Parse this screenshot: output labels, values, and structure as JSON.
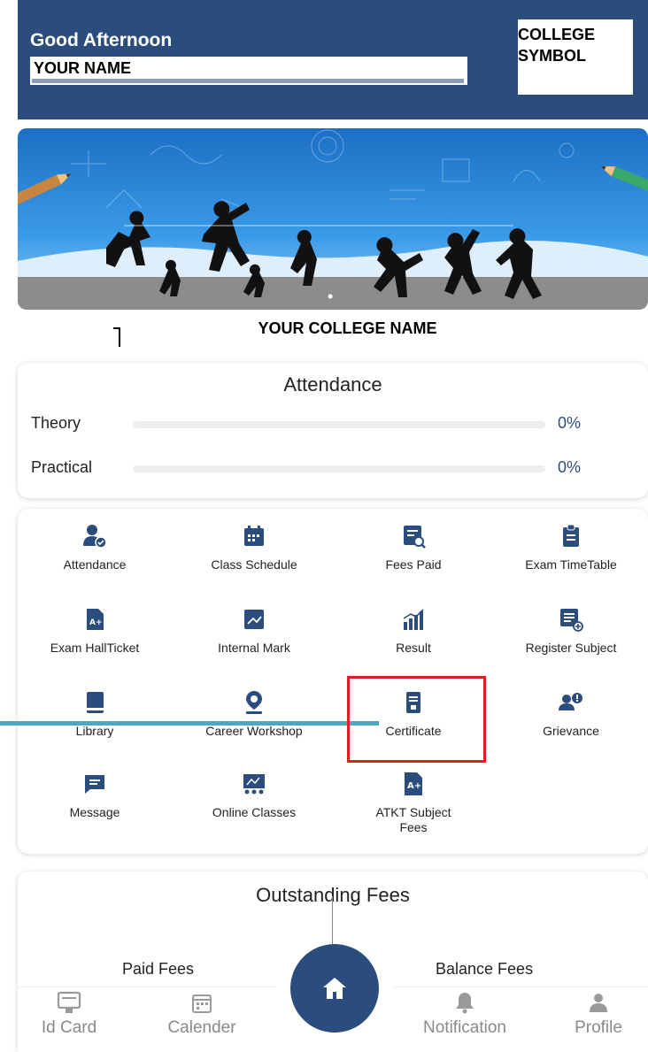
{
  "header": {
    "greeting": "Good Afternoon",
    "user_name": "YOUR NAME",
    "logo_text": "COLLEGE SYMBOL",
    "bg_color": "#2b4d7e"
  },
  "banner": {
    "college_name": "YOUR COLLEGE NAME",
    "slide_indicator": "•"
  },
  "attendance": {
    "title": "Attendance",
    "rows": [
      {
        "label": "Theory",
        "value": "0%",
        "fraction": 0
      },
      {
        "label": "Practical",
        "value": "0%",
        "fraction": 0
      }
    ]
  },
  "menu": {
    "items": [
      {
        "label": "Attendance",
        "icon": "attendance-user-check-icon"
      },
      {
        "label": "Class Schedule",
        "icon": "calendar-icon"
      },
      {
        "label": "Fees Paid",
        "icon": "receipt-search-icon"
      },
      {
        "label": "Exam TimeTable",
        "icon": "clipboard-icon"
      },
      {
        "label": "Exam HallTicket",
        "icon": "grade-document-icon"
      },
      {
        "label": "Internal Mark",
        "icon": "chart-trend-icon"
      },
      {
        "label": "Result",
        "icon": "bar-chart-icon"
      },
      {
        "label": "Register Subject",
        "icon": "list-add-icon"
      },
      {
        "label": "Library",
        "icon": "book-icon"
      },
      {
        "label": "Career Workshop",
        "icon": "location-badge-icon"
      },
      {
        "label": "Certificate",
        "icon": "certificate-icon"
      },
      {
        "label": "Grievance",
        "icon": "user-alert-icon"
      },
      {
        "label": "Message",
        "icon": "message-icon"
      },
      {
        "label": "Online Classes",
        "icon": "online-class-icon"
      },
      {
        "label": "ATKT Subject Fees",
        "icon": "grade-plus-icon"
      }
    ]
  },
  "fees": {
    "title": "Outstanding Fees",
    "paid_label": "Paid Fees",
    "balance_label": "Balance Fees"
  },
  "bottom_nav": {
    "items": [
      {
        "label": "Id Card",
        "icon": "id-card-icon"
      },
      {
        "label": "Calender",
        "icon": "calendar-icon"
      },
      {
        "label": "Notification",
        "icon": "bell-icon"
      },
      {
        "label": "Profile",
        "icon": "profile-icon"
      }
    ],
    "home_icon": "home-icon"
  },
  "colors": {
    "primary": "#2b4d7e",
    "highlight": "#e02020",
    "annotation_line": "#4aa8c0"
  }
}
